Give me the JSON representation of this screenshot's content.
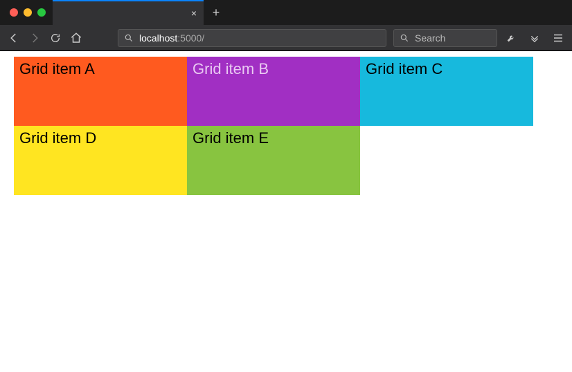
{
  "browser": {
    "tab_close_glyph": "×",
    "newtab_glyph": "+",
    "url": {
      "host": "localhost",
      "rest": ":5000/"
    },
    "search_placeholder": "Search"
  },
  "grid": {
    "cells": [
      {
        "label": "Grid item A",
        "bg": "#ff5a1f",
        "fg": "#000000"
      },
      {
        "label": "Grid item B",
        "bg": "#a12fc3",
        "fg": "#e9c9f2"
      },
      {
        "label": "Grid item C",
        "bg": "#17b9dd",
        "fg": "#000000"
      },
      {
        "label": "Grid item D",
        "bg": "#ffe521",
        "fg": "#000000"
      },
      {
        "label": "Grid item E",
        "bg": "#88c440",
        "fg": "#000000"
      }
    ]
  }
}
